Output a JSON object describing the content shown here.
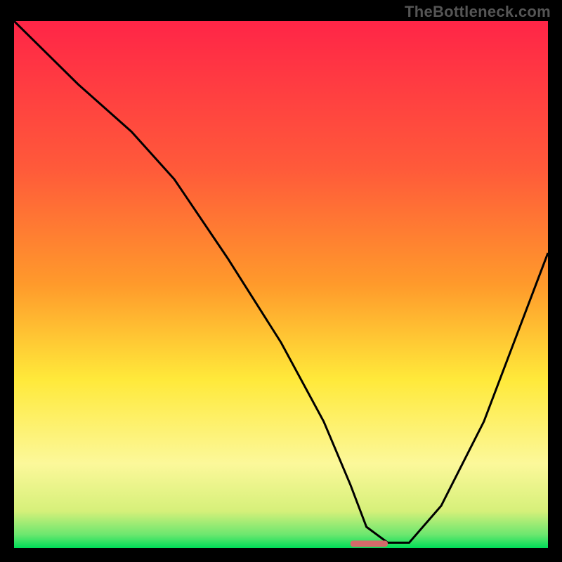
{
  "watermark": "TheBottleneck.com",
  "colors": {
    "red": "#ff2547",
    "orange": "#ff9a2b",
    "yellow": "#ffe93a",
    "yellowPale": "#fff9a0",
    "green": "#00e060",
    "black": "#000000",
    "curve": "#000000",
    "marker": "#d46a6a"
  },
  "chart_data": {
    "type": "line",
    "title": "",
    "xlabel": "",
    "ylabel": "",
    "xlim": [
      0,
      100
    ],
    "ylim": [
      0,
      100
    ],
    "x": [
      0,
      12,
      22,
      30,
      40,
      50,
      58,
      63,
      66,
      70,
      74,
      80,
      88,
      94,
      100
    ],
    "values": [
      100,
      88,
      79,
      70,
      55,
      39,
      24,
      12,
      4,
      1,
      1,
      8,
      24,
      40,
      56
    ],
    "marker_bar": {
      "x_start": 63,
      "x_end": 70,
      "y": 0.8,
      "thickness": 1.2
    },
    "gradient_stops": [
      {
        "offset": 0.0,
        "color": "#ff2547"
      },
      {
        "offset": 0.28,
        "color": "#ff5a3a"
      },
      {
        "offset": 0.5,
        "color": "#ff9a2b"
      },
      {
        "offset": 0.68,
        "color": "#ffe93a"
      },
      {
        "offset": 0.84,
        "color": "#fcf89a"
      },
      {
        "offset": 0.93,
        "color": "#d6f07a"
      },
      {
        "offset": 0.975,
        "color": "#6be76f"
      },
      {
        "offset": 1.0,
        "color": "#00dd58"
      }
    ]
  }
}
